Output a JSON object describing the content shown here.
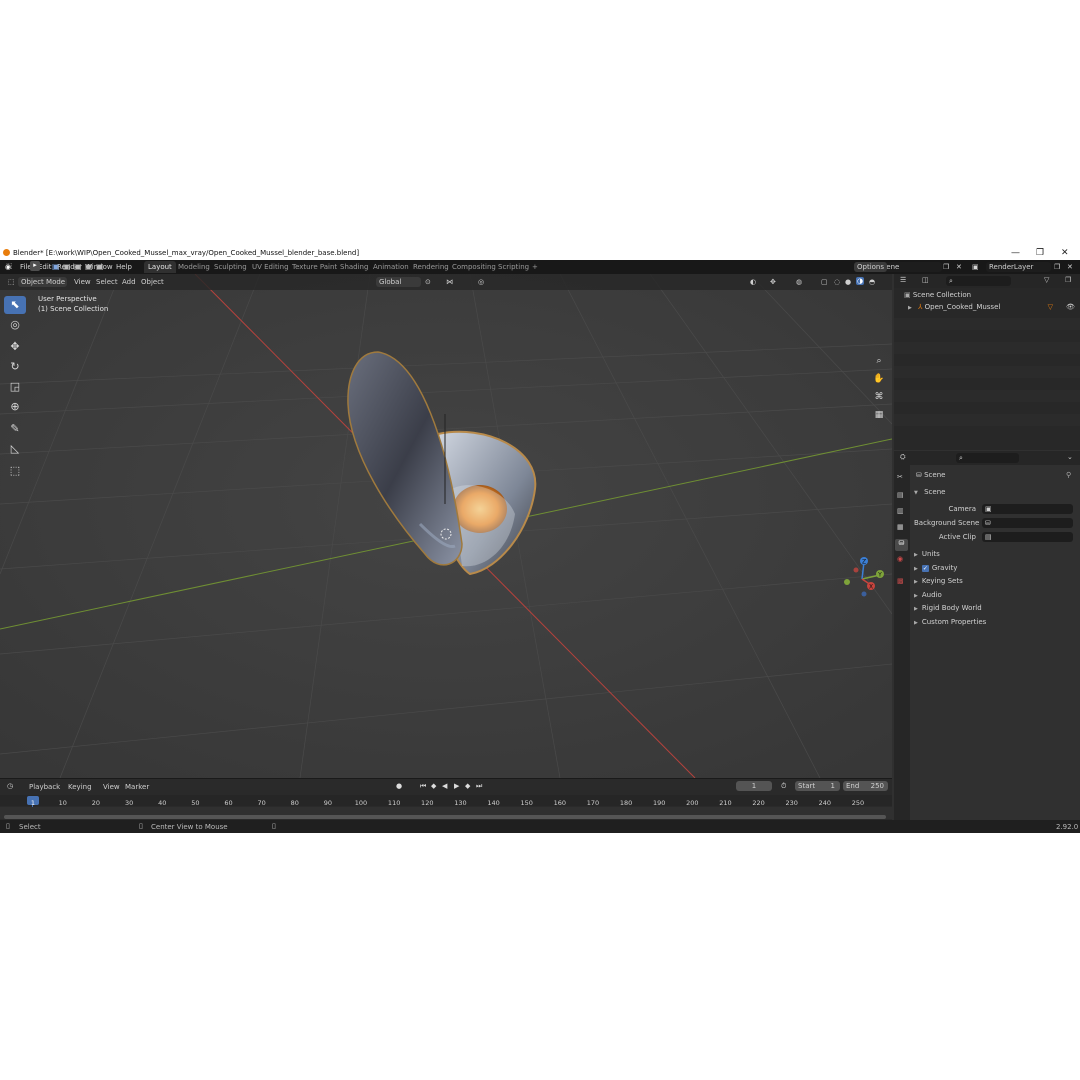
{
  "titlebar": {
    "title": "Blender* [E:\\work\\WIP\\Open_Cooked_Mussel_max_vray/Open_Cooked_Mussel_blender_base.blend]",
    "minimize": "—",
    "maximize": "❐",
    "close": "✕"
  },
  "menu": {
    "items": [
      "File",
      "Edit",
      "Render",
      "Window",
      "Help"
    ]
  },
  "workspaces": {
    "tabs": [
      "Layout",
      "Modeling",
      "Sculpting",
      "UV Editing",
      "Texture Paint",
      "Shading",
      "Animation",
      "Rendering",
      "Compositing",
      "Scripting"
    ],
    "active": "Layout",
    "add": "+"
  },
  "scene_selector": {
    "value": "Scene"
  },
  "viewlayer_selector": {
    "value": "RenderLayer"
  },
  "viewport_header": {
    "mode": "Object Mode",
    "menus": [
      "View",
      "Select",
      "Add",
      "Object"
    ],
    "orientation": "Global",
    "options": "Options"
  },
  "viewport": {
    "perspective_label": "User Perspective",
    "collection_label": "(1) Scene Collection",
    "axis_colors": {
      "x": "#c8443d",
      "y": "#7ea33a",
      "z": "#3b7fd6"
    },
    "gizmo_labels": {
      "x": "X",
      "y": "Y",
      "z": "Z"
    }
  },
  "timeline": {
    "menus": [
      "Playback",
      "Keying",
      "View",
      "Marker"
    ],
    "current_frame": "1",
    "start_label": "Start",
    "start_value": "1",
    "end_label": "End",
    "end_value": "250",
    "ticks": [
      "1",
      "10",
      "20",
      "30",
      "40",
      "50",
      "60",
      "70",
      "80",
      "90",
      "100",
      "110",
      "120",
      "130",
      "140",
      "150",
      "160",
      "170",
      "180",
      "190",
      "200",
      "210",
      "220",
      "230",
      "240",
      "250"
    ]
  },
  "statusbar": {
    "left": "Select",
    "middle": "Center View to Mouse",
    "version": "2.92.0"
  },
  "outliner": {
    "root": "Scene Collection",
    "items": [
      "Open_Cooked_Mussel"
    ]
  },
  "properties": {
    "context": "Scene",
    "panel": "Scene",
    "fields": [
      {
        "label": "Camera",
        "value": ""
      },
      {
        "label": "Background Scene",
        "value": ""
      },
      {
        "label": "Active Clip",
        "value": ""
      }
    ],
    "sections": [
      "Units",
      "Gravity",
      "Keying Sets",
      "Audio",
      "Rigid Body World",
      "Custom Properties"
    ],
    "gravity_checked": true
  },
  "accent_color": "#4772b3",
  "orange_accent": "#e87d0d"
}
